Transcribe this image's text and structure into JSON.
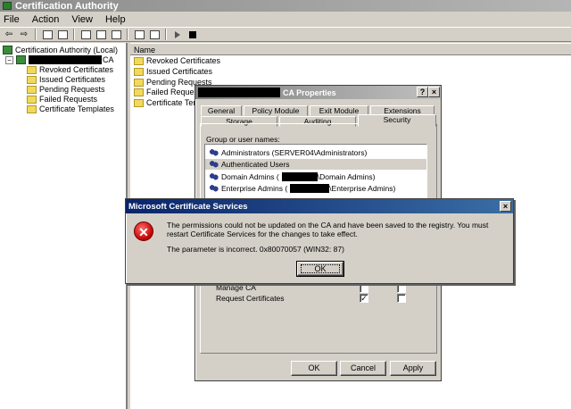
{
  "window": {
    "title": "Certification Authority"
  },
  "menu": [
    "File",
    "Action",
    "View",
    "Help"
  ],
  "tree": {
    "root": "Certification Authority (Local)",
    "ca_suffix": "CA",
    "children": [
      "Revoked Certificates",
      "Issued Certificates",
      "Pending Requests",
      "Failed Requests",
      "Certificate Templates"
    ]
  },
  "list": {
    "column": "Name",
    "items": [
      "Revoked Certificates",
      "Issued Certificates",
      "Pending Requests",
      "Failed Requests",
      "Certificate Temp"
    ]
  },
  "properties": {
    "title_suffix": "CA Properties",
    "help_btn": "?",
    "close_btn": "×",
    "tabs_top": [
      "General",
      "Policy Module",
      "Exit Module",
      "Extensions"
    ],
    "tabs_bottom": [
      "Storage",
      "Auditing",
      "Security"
    ],
    "group_label": "Group or user names:",
    "users": {
      "u0": "Administrators (SERVER04\\Administrators)",
      "u1": "Authenticated Users",
      "u2_pre": "Domain Admins (",
      "u2_post": "\\Domain Admins)",
      "u3_pre": "Enterprise Admins (",
      "u3_post": "\\Enterprise Admins)"
    },
    "permissions": {
      "p0": {
        "name": "Manage CA",
        "allow": false,
        "deny": false
      },
      "p1": {
        "name": "Request Certificates",
        "allow": true,
        "deny": false
      }
    },
    "buttons": {
      "ok": "OK",
      "cancel": "Cancel",
      "apply": "Apply"
    }
  },
  "error": {
    "title": "Microsoft Certificate Services",
    "close_btn": "×",
    "message": "The permissions could not be updated on the CA and have been saved to the registry. You must restart Certificate Services for the changes to take effect.",
    "param": "The parameter is incorrect. 0x80070057 (WIN32: 87)",
    "ok": "OK"
  },
  "icons": {
    "app": "ca-icon",
    "back": "back-arrow-icon",
    "forward": "forward-arrow-icon",
    "error": "error-icon",
    "folder": "folder-icon",
    "user_group": "user-group-icon"
  },
  "colors": {
    "error_title": "#0a246a",
    "inactive_title": "#808080",
    "error_icon": "#c00000"
  }
}
